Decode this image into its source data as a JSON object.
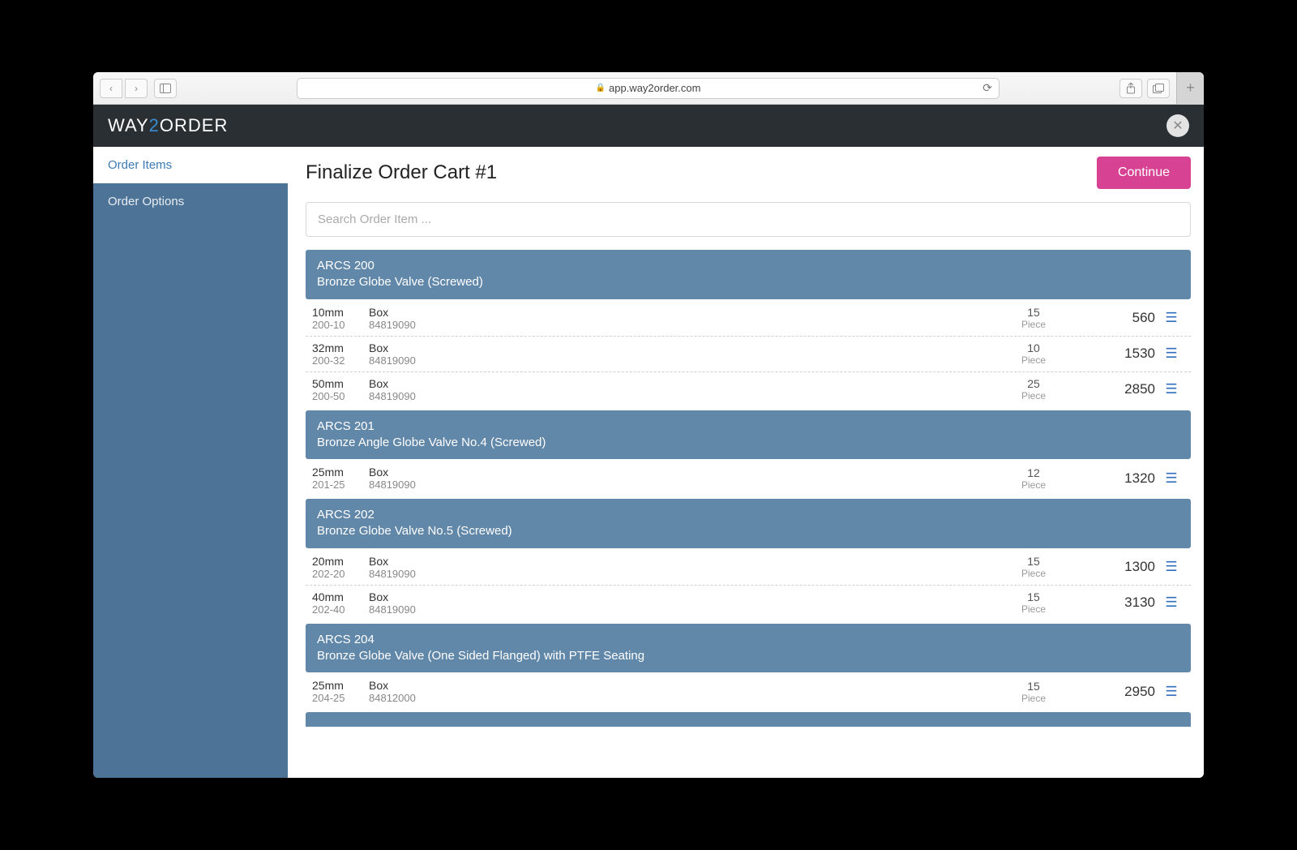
{
  "browser": {
    "url_display": "app.way2order.com"
  },
  "brand": {
    "part1": "WAY",
    "part2": "2",
    "part3": "ORDER"
  },
  "sidebar": {
    "items": [
      {
        "label": "Order Items",
        "active": true
      },
      {
        "label": "Order Options",
        "active": false
      }
    ]
  },
  "main": {
    "title": "Finalize Order Cart #1",
    "continue_label": "Continue",
    "search_placeholder": "Search Order Item ..."
  },
  "groups": [
    {
      "code": "ARCS 200",
      "description": "Bronze Globe Valve (Screwed)",
      "rows": [
        {
          "size": "10mm",
          "pack": "Box",
          "sku": "200-10",
          "hs": "84819090",
          "qty": "15",
          "unit": "Piece",
          "price": "560"
        },
        {
          "size": "32mm",
          "pack": "Box",
          "sku": "200-32",
          "hs": "84819090",
          "qty": "10",
          "unit": "Piece",
          "price": "1530"
        },
        {
          "size": "50mm",
          "pack": "Box",
          "sku": "200-50",
          "hs": "84819090",
          "qty": "25",
          "unit": "Piece",
          "price": "2850"
        }
      ]
    },
    {
      "code": "ARCS 201",
      "description": "Bronze Angle Globe Valve No.4 (Screwed)",
      "rows": [
        {
          "size": "25mm",
          "pack": "Box",
          "sku": "201-25",
          "hs": "84819090",
          "qty": "12",
          "unit": "Piece",
          "price": "1320"
        }
      ]
    },
    {
      "code": "ARCS 202",
      "description": "Bronze Globe Valve No.5 (Screwed)",
      "rows": [
        {
          "size": "20mm",
          "pack": "Box",
          "sku": "202-20",
          "hs": "84819090",
          "qty": "15",
          "unit": "Piece",
          "price": "1300"
        },
        {
          "size": "40mm",
          "pack": "Box",
          "sku": "202-40",
          "hs": "84819090",
          "qty": "15",
          "unit": "Piece",
          "price": "3130"
        }
      ]
    },
    {
      "code": "ARCS 204",
      "description": "Bronze Globe Valve (One Sided Flanged) with PTFE Seating",
      "rows": [
        {
          "size": "25mm",
          "pack": "Box",
          "sku": "204-25",
          "hs": "84812000",
          "qty": "15",
          "unit": "Piece",
          "price": "2950"
        }
      ]
    }
  ]
}
